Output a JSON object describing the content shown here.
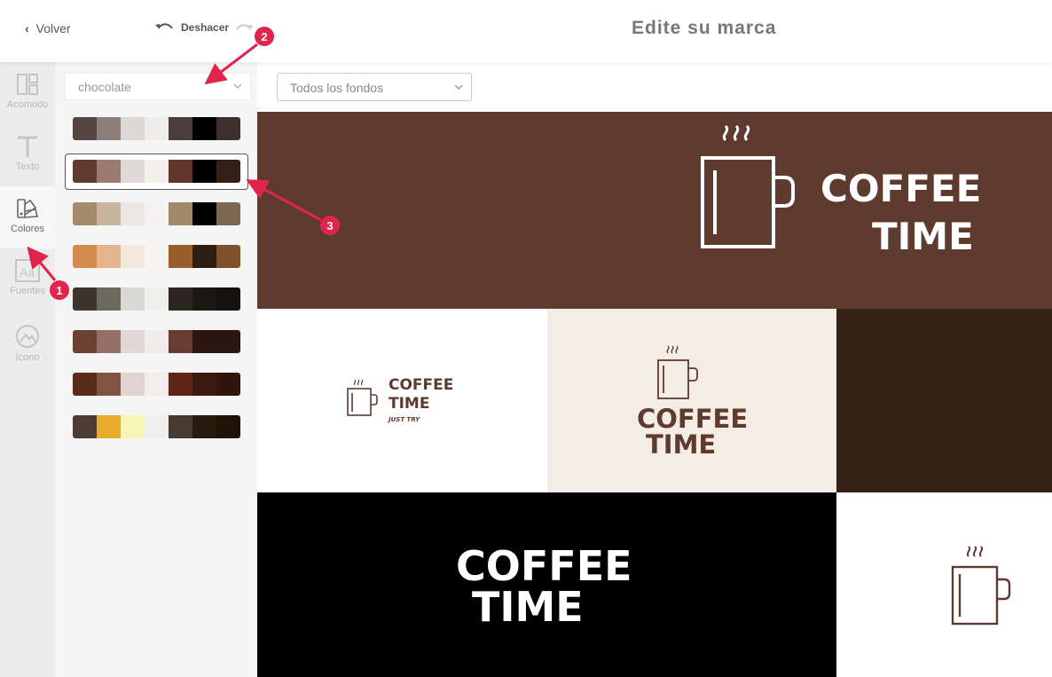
{
  "header": {
    "back_label": "Volver",
    "undo_label": "Deshacer",
    "title": "Edite su marca"
  },
  "rail": {
    "items": [
      {
        "label": "Acomodo",
        "icon": "layout-icon",
        "active": false
      },
      {
        "label": "Texto",
        "icon": "text-icon",
        "active": false
      },
      {
        "label": "Colores",
        "icon": "palette-icon",
        "active": true
      },
      {
        "label": "Fuentes",
        "icon": "font-icon",
        "active": false
      },
      {
        "label": "Ícono",
        "icon": "image-icon",
        "active": false
      }
    ]
  },
  "palette_panel": {
    "selected_palette": "chocolate",
    "palettes": [
      [
        "#564641",
        "#8c7e79",
        "#dcd8d6",
        "#efedec",
        "#4c3f3b",
        "#000000",
        "#3c302c"
      ],
      [
        "#5f3a2e",
        "#9b7b6f",
        "#e1d9d6",
        "#f3f0ea",
        "#5f382b",
        "#000000",
        "#332017"
      ],
      [
        "#a58a6b",
        "#c8b59f",
        "#ece7e1",
        "#f4f3f1",
        "#a08a6b",
        "#000000",
        "#7a6852"
      ],
      [
        "#d48b4f",
        "#e4b58e",
        "#f4e8dd",
        "#f7f3ef",
        "#9a5e2c",
        "#2d1d12",
        "#7e502c"
      ],
      [
        "#3d352b",
        "#6c6a5f",
        "#d8d8d6",
        "#eeeeec",
        "#2b2620",
        "#1b1814",
        "#15120f"
      ],
      [
        "#6d4034",
        "#937067",
        "#e2d7d5",
        "#f1ecec",
        "#693c31",
        "#2b1712",
        "#2a1612"
      ],
      [
        "#5c2a1b",
        "#825444",
        "#e0d4d1",
        "#f2ecea",
        "#5f2618",
        "#3c1a10",
        "#2f150c"
      ],
      [
        "#4c3c31",
        "#e8ac2b",
        "#f6f5b5",
        "#efefef",
        "#463a31",
        "#2a1a0d",
        "#1f1207"
      ]
    ],
    "selected_index": 1
  },
  "background_select": {
    "value": "Todos los fondos"
  },
  "logo": {
    "line1": "COFFEE",
    "line2": "TIME",
    "tagline": "JUST TRY"
  },
  "colors": {
    "accent": "#e0244a",
    "brown": "#5f3a2e",
    "cream": "#f3ede5",
    "dark": "#332017",
    "black": "#000000",
    "white": "#ffffff"
  },
  "annotations": [
    "1",
    "2",
    "3"
  ]
}
